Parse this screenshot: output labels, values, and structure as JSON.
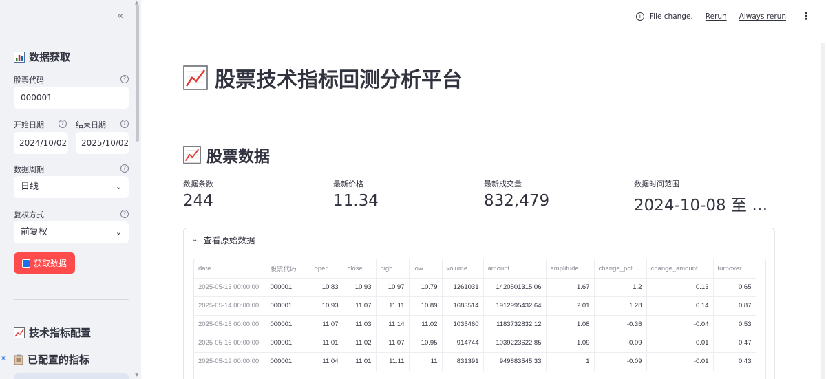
{
  "sidebar": {
    "collapse_glyph": "«",
    "section1_title": "数据获取",
    "stock_code_label": "股票代码",
    "stock_code_value": "000001",
    "start_date_label": "开始日期",
    "start_date_value": "2024/10/02",
    "end_date_label": "结束日期",
    "end_date_value": "2025/10/02",
    "period_label": "数据周期",
    "period_value": "日线",
    "adjust_label": "复权方式",
    "adjust_value": "前复权",
    "fetch_button": "获取数据",
    "section2_title": "技术指标配置",
    "section3_title": "已配置的指标",
    "help_glyph": "?"
  },
  "toolbar": {
    "file_change": "File change.",
    "rerun": "Rerun",
    "always_rerun": "Always rerun",
    "info_glyph": "i",
    "menu_glyph": "⋮"
  },
  "main": {
    "page_title": "股票技术指标回测分析平台",
    "section_title": "股票数据",
    "metrics": [
      {
        "label": "数据条数",
        "value": "244"
      },
      {
        "label": "最新价格",
        "value": "11.34"
      },
      {
        "label": "最新成交量",
        "value": "832,479"
      },
      {
        "label": "数据时间范围",
        "value": "2024-10-08 至 …"
      }
    ],
    "expander_label": "查看原始数据",
    "table": {
      "columns": [
        "date",
        "股票代码",
        "open",
        "close",
        "high",
        "low",
        "volume",
        "amount",
        "amplitude",
        "change_pct",
        "change_amount",
        "turnover"
      ],
      "rows": [
        [
          "2025-05-13 00:00:00",
          "000001",
          "10.83",
          "10.93",
          "10.97",
          "10.79",
          "1261031",
          "1420501315.06",
          "1.67",
          "1.2",
          "0.13",
          "0.65"
        ],
        [
          "2025-05-14 00:00:00",
          "000001",
          "10.93",
          "11.07",
          "11.11",
          "10.89",
          "1683514",
          "1912995432.64",
          "2.01",
          "1.28",
          "0.14",
          "0.87"
        ],
        [
          "2025-05-15 00:00:00",
          "000001",
          "11.07",
          "11.03",
          "11.14",
          "11.02",
          "1035460",
          "1183732832.12",
          "1.08",
          "-0.36",
          "-0.04",
          "0.53"
        ],
        [
          "2025-05-16 00:00:00",
          "000001",
          "11.01",
          "11.02",
          "11.07",
          "10.95",
          "914744",
          "1039223622.85",
          "1.09",
          "-0.09",
          "-0.01",
          "0.47"
        ],
        [
          "2025-05-19 00:00:00",
          "000001",
          "11.04",
          "11.01",
          "11.11",
          "11",
          "831391",
          "949883545.33",
          "1",
          "-0.09",
          "-0.01",
          "0.43"
        ]
      ]
    }
  },
  "colors": {
    "primary": "#ff4b4b",
    "sidebar_bg": "#f0f2f6",
    "text": "#31333f"
  }
}
